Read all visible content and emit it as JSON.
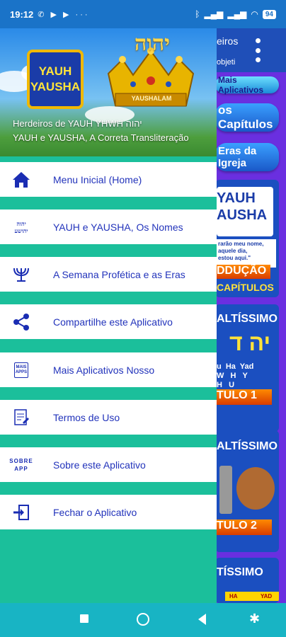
{
  "status_bar": {
    "time": "19:12",
    "left_glyphs": "✆ ▶ ▶ ···",
    "battery": "94"
  },
  "background_app": {
    "header_text_1": "eiros",
    "header_text_2": "objeti",
    "pill_1": "Mais Aplicativos",
    "pill_2": "os Capítulos",
    "pill_3": "Eras da Igreja",
    "card1_title": "YAUH\nAUSHA",
    "card1_text": "rarão meu nome,\naquele dia,\nestou aqui.\"",
    "card1_btn": "DDUÇÃO",
    "card1_btn2": "CAPÍTULOS",
    "card2_title": "ALTÍSSIMO",
    "card2_letters": "u  Ha  Yad\nW   H   Y\nH   U",
    "card2_btn": "TULO 1",
    "card3_title": "ALTÍSSIMO",
    "card3_btn": "TULO 2",
    "card4_title": "TÍSSIMO",
    "card4_tags": [
      "HA",
      "YAD"
    ]
  },
  "drawer": {
    "logo_line1": "YAUH",
    "logo_line2": "YAUSHA",
    "crown_hebrew": "יהוה",
    "crown_band": "YAUSHALAM",
    "title": "Herdeiros de YAUH YHWH יהוה",
    "subtitle": "YAUH e YAUSHA, A Correta Transliteração",
    "items": [
      {
        "label": "Menu Inicial (Home)"
      },
      {
        "label": "YAUH e YAUSHA, Os Nomes",
        "icon_text": "יהוה\nיהושע"
      },
      {
        "label": "A Semana Profética e as Eras"
      },
      {
        "label": "Compartilhe este Aplicativo"
      },
      {
        "label": "Mais Aplicativos Nosso",
        "icon_text": "MAIS\nAPPS"
      },
      {
        "label": "Termos de Uso"
      },
      {
        "label": "Sobre este Aplicativo",
        "icon_text": "SOBRE\nAPP"
      },
      {
        "label": "Fechar o Aplicativo"
      }
    ]
  },
  "colors": {
    "drawer_bg": "#1bbf9b",
    "item_text": "#2233bb",
    "status_bar": "#1a73c8",
    "nav_bar": "#18b4c4"
  },
  "icons": [
    "home-icon",
    "names-icon",
    "menorah-icon",
    "share-icon",
    "apps-icon",
    "terms-icon",
    "about-icon",
    "exit-icon"
  ]
}
